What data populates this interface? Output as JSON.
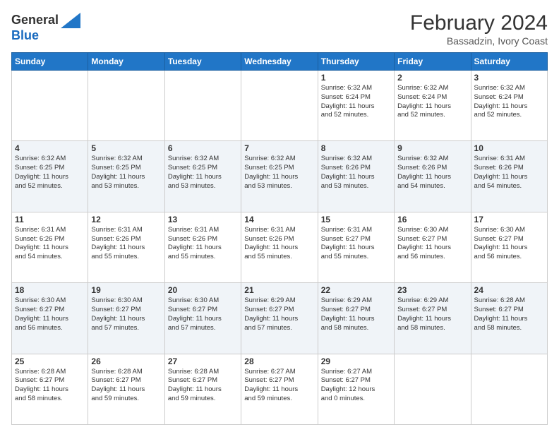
{
  "header": {
    "logo_general": "General",
    "logo_blue": "Blue",
    "month_year": "February 2024",
    "location": "Bassadzin, Ivory Coast"
  },
  "days_of_week": [
    "Sunday",
    "Monday",
    "Tuesday",
    "Wednesday",
    "Thursday",
    "Friday",
    "Saturday"
  ],
  "weeks": [
    [
      {
        "day": "",
        "info": ""
      },
      {
        "day": "",
        "info": ""
      },
      {
        "day": "",
        "info": ""
      },
      {
        "day": "",
        "info": ""
      },
      {
        "day": "1",
        "info": "Sunrise: 6:32 AM\nSunset: 6:24 PM\nDaylight: 11 hours\nand 52 minutes."
      },
      {
        "day": "2",
        "info": "Sunrise: 6:32 AM\nSunset: 6:24 PM\nDaylight: 11 hours\nand 52 minutes."
      },
      {
        "day": "3",
        "info": "Sunrise: 6:32 AM\nSunset: 6:24 PM\nDaylight: 11 hours\nand 52 minutes."
      }
    ],
    [
      {
        "day": "4",
        "info": "Sunrise: 6:32 AM\nSunset: 6:25 PM\nDaylight: 11 hours\nand 52 minutes."
      },
      {
        "day": "5",
        "info": "Sunrise: 6:32 AM\nSunset: 6:25 PM\nDaylight: 11 hours\nand 53 minutes."
      },
      {
        "day": "6",
        "info": "Sunrise: 6:32 AM\nSunset: 6:25 PM\nDaylight: 11 hours\nand 53 minutes."
      },
      {
        "day": "7",
        "info": "Sunrise: 6:32 AM\nSunset: 6:25 PM\nDaylight: 11 hours\nand 53 minutes."
      },
      {
        "day": "8",
        "info": "Sunrise: 6:32 AM\nSunset: 6:26 PM\nDaylight: 11 hours\nand 53 minutes."
      },
      {
        "day": "9",
        "info": "Sunrise: 6:32 AM\nSunset: 6:26 PM\nDaylight: 11 hours\nand 54 minutes."
      },
      {
        "day": "10",
        "info": "Sunrise: 6:31 AM\nSunset: 6:26 PM\nDaylight: 11 hours\nand 54 minutes."
      }
    ],
    [
      {
        "day": "11",
        "info": "Sunrise: 6:31 AM\nSunset: 6:26 PM\nDaylight: 11 hours\nand 54 minutes."
      },
      {
        "day": "12",
        "info": "Sunrise: 6:31 AM\nSunset: 6:26 PM\nDaylight: 11 hours\nand 55 minutes."
      },
      {
        "day": "13",
        "info": "Sunrise: 6:31 AM\nSunset: 6:26 PM\nDaylight: 11 hours\nand 55 minutes."
      },
      {
        "day": "14",
        "info": "Sunrise: 6:31 AM\nSunset: 6:26 PM\nDaylight: 11 hours\nand 55 minutes."
      },
      {
        "day": "15",
        "info": "Sunrise: 6:31 AM\nSunset: 6:27 PM\nDaylight: 11 hours\nand 55 minutes."
      },
      {
        "day": "16",
        "info": "Sunrise: 6:30 AM\nSunset: 6:27 PM\nDaylight: 11 hours\nand 56 minutes."
      },
      {
        "day": "17",
        "info": "Sunrise: 6:30 AM\nSunset: 6:27 PM\nDaylight: 11 hours\nand 56 minutes."
      }
    ],
    [
      {
        "day": "18",
        "info": "Sunrise: 6:30 AM\nSunset: 6:27 PM\nDaylight: 11 hours\nand 56 minutes."
      },
      {
        "day": "19",
        "info": "Sunrise: 6:30 AM\nSunset: 6:27 PM\nDaylight: 11 hours\nand 57 minutes."
      },
      {
        "day": "20",
        "info": "Sunrise: 6:30 AM\nSunset: 6:27 PM\nDaylight: 11 hours\nand 57 minutes."
      },
      {
        "day": "21",
        "info": "Sunrise: 6:29 AM\nSunset: 6:27 PM\nDaylight: 11 hours\nand 57 minutes."
      },
      {
        "day": "22",
        "info": "Sunrise: 6:29 AM\nSunset: 6:27 PM\nDaylight: 11 hours\nand 58 minutes."
      },
      {
        "day": "23",
        "info": "Sunrise: 6:29 AM\nSunset: 6:27 PM\nDaylight: 11 hours\nand 58 minutes."
      },
      {
        "day": "24",
        "info": "Sunrise: 6:28 AM\nSunset: 6:27 PM\nDaylight: 11 hours\nand 58 minutes."
      }
    ],
    [
      {
        "day": "25",
        "info": "Sunrise: 6:28 AM\nSunset: 6:27 PM\nDaylight: 11 hours\nand 58 minutes."
      },
      {
        "day": "26",
        "info": "Sunrise: 6:28 AM\nSunset: 6:27 PM\nDaylight: 11 hours\nand 59 minutes."
      },
      {
        "day": "27",
        "info": "Sunrise: 6:28 AM\nSunset: 6:27 PM\nDaylight: 11 hours\nand 59 minutes."
      },
      {
        "day": "28",
        "info": "Sunrise: 6:27 AM\nSunset: 6:27 PM\nDaylight: 11 hours\nand 59 minutes."
      },
      {
        "day": "29",
        "info": "Sunrise: 6:27 AM\nSunset: 6:27 PM\nDaylight: 12 hours\nand 0 minutes."
      },
      {
        "day": "",
        "info": ""
      },
      {
        "day": "",
        "info": ""
      }
    ]
  ]
}
